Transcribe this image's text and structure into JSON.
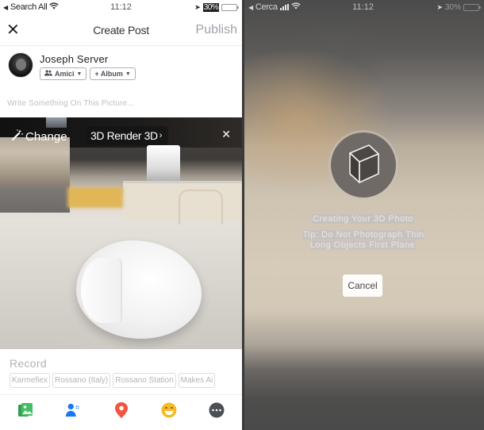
{
  "left": {
    "statusbar": {
      "back_label": "Search All",
      "time": "11:12",
      "battery_percent": "30%",
      "battery_level": 0.3
    },
    "navbar": {
      "title": "Create Post",
      "publish_label": "Publish"
    },
    "author": {
      "name": "Joseph Server",
      "audience_label": "Amici",
      "album_label": "+ Album"
    },
    "composer": {
      "placeholder": "Write Something On This Picture..."
    },
    "photo": {
      "change_label": "Change",
      "render_label": "3D Render 3D"
    },
    "location": {
      "title": "Record",
      "suggestions": [
        "Karmefiex",
        "Rossano (Italy)",
        "Rossano Station",
        "Makes Ai"
      ]
    },
    "actions": [
      {
        "name": "photo-icon",
        "color": "#45bd62"
      },
      {
        "name": "tag-people-icon",
        "color": "#1877f2"
      },
      {
        "name": "location-pin-icon",
        "color": "#f02849"
      },
      {
        "name": "feeling-emoji-icon",
        "color": "#f7b928"
      },
      {
        "name": "more-icon",
        "color": "#4b4f56"
      }
    ]
  },
  "right": {
    "statusbar": {
      "back_label": "Cerca",
      "time": "11:12",
      "battery_percent": "30%",
      "battery_level": 0.3
    },
    "progress": {
      "title": "Creating Your 3D Photo",
      "tip": "Tip: Do Not Photograph Thin Long Objects First Plane"
    },
    "cancel_label": "Cancel"
  }
}
